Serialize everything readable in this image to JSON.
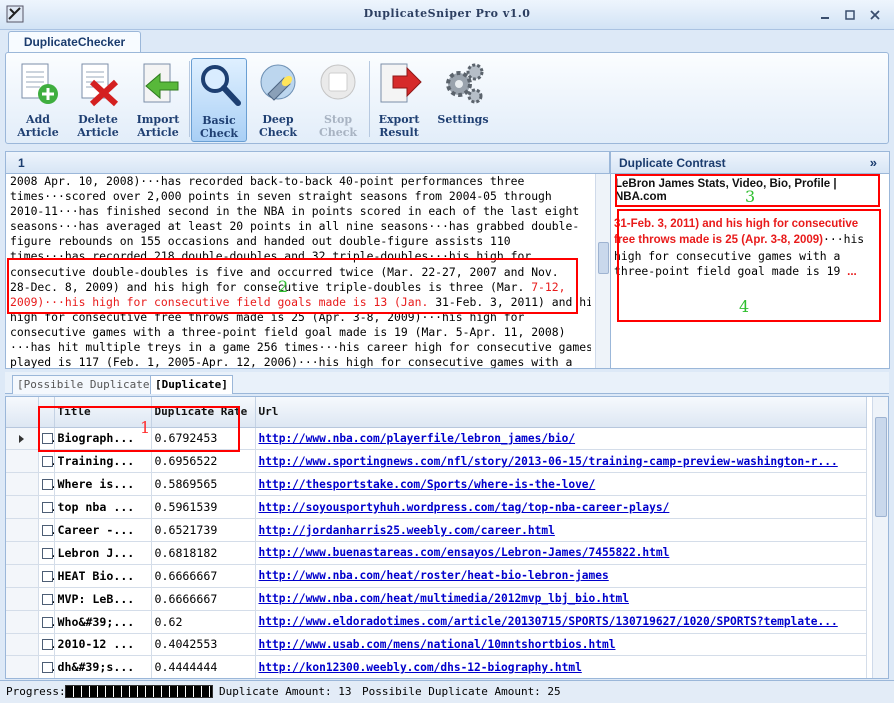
{
  "window": {
    "title": "DuplicateSniper Pro v1.0"
  },
  "ribbon": {
    "tab_label": "DuplicateChecker",
    "tools": [
      {
        "line1": "Add",
        "line2": "Article",
        "icon": "add-article-icon"
      },
      {
        "line1": "Delete",
        "line2": "Article",
        "icon": "delete-article-icon"
      },
      {
        "line1": "Import",
        "line2": "Article",
        "icon": "import-article-icon"
      },
      {
        "line1": "Basic",
        "line2": "Check",
        "icon": "magnifier-icon"
      },
      {
        "line1": "Deep",
        "line2": "Check",
        "icon": "flashlight-icon"
      },
      {
        "line1": "Stop",
        "line2": "Check",
        "icon": "stop-icon"
      },
      {
        "line1": "Export",
        "line2": "Result",
        "icon": "export-icon"
      },
      {
        "line1": "Settings",
        "line2": "",
        "icon": "gears-icon"
      }
    ]
  },
  "article": {
    "header": "1",
    "lines": [
      "2008 Apr. 10, 2008)···has recorded back-to-back 40-point performances three",
      "times···scored over 2,000 points in seven straight seasons from 2004-05 through",
      "2010-11···has finished second in the NBA in points scored in each of the last eight",
      "seasons···has averaged at least 20 points in all nine seasons···has grabbed double-",
      "figure rebounds on 155 occasions and handed out double-figure assists 110",
      "times···has recorded 218 double-doubles and 32 triple-doubles···his high for",
      "consecutive double-doubles is five and occurred twice (Mar. 22-27, 2007 and Nov."
    ],
    "line8_a": "28-Dec. 8, 2009) and his high for consecutive triple-doubles is three (Mar. ",
    "line8_b": "7-12,",
    "line9_a": "2009)···his high for consecutive field goals made is 13 (Jan. ",
    "line9_b": "31-Feb. 3, 2011) and his",
    "lines_after": [
      "high for consecutive free throws made is 25 (Apr. 3-8, 2009)···his high for",
      "consecutive games with a three-point field goal made is 19 (Mar. 5-Apr. 11, 2008)",
      "···has hit multiple treys in a game 256 times···his career high for consecutive games",
      "played is 117 (Feb. 1, 2005-Apr. 12, 2006)···his high for consecutive games with a"
    ]
  },
  "contrast": {
    "header": "Duplicate Contrast",
    "chevron": "»",
    "source_title": "LeBron James Stats, Video, Bio, Profile | NBA.com",
    "red_text": "31-Feb. 3, 2011) and his high for consecutive free throws made is 25 (Apr. 3-8, 2009)",
    "tail_text": "···his high for consecutive games with a three-point field goal made is 19 ",
    "ellipsis": "..."
  },
  "annotations": {
    "m1": "1",
    "m2": "2",
    "m3": "3",
    "m4": "4"
  },
  "tabs": {
    "possible": "[Possibile Duplicate]",
    "duplicate": "[Duplicate]"
  },
  "grid": {
    "columns": {
      "title": "Title",
      "rate": "Duplicate Rate",
      "url": "Url"
    },
    "rows": [
      {
        "title": "Biograph...",
        "rate": "0.6792453",
        "url": "http://www.nba.com/playerfile/lebron_james/bio/"
      },
      {
        "title": "Training...",
        "rate": "0.6956522",
        "url": "http://www.sportingnews.com/nfl/story/2013-06-15/training-camp-preview-washington-r..."
      },
      {
        "title": "Where is...",
        "rate": "0.5869565",
        "url": "http://thesportstake.com/Sports/where-is-the-love/"
      },
      {
        "title": "top nba ...",
        "rate": "0.5961539",
        "url": "http://soyousportyhuh.wordpress.com/tag/top-nba-career-plays/"
      },
      {
        "title": "Career -...",
        "rate": "0.6521739",
        "url": "http://jordanharris25.weebly.com/career.html"
      },
      {
        "title": "Lebron J...",
        "rate": "0.6818182",
        "url": "http://www.buenastareas.com/ensayos/Lebron-James/7455822.html"
      },
      {
        "title": "HEAT Bio...",
        "rate": "0.6666667",
        "url": "http://www.nba.com/heat/roster/heat-bio-lebron-james"
      },
      {
        "title": "MVP: LeB...",
        "rate": "0.6666667",
        "url": "http://www.nba.com/heat/multimedia/2012mvp_lbj_bio.html"
      },
      {
        "title": "Who&#39;...",
        "rate": "0.62",
        "url": "http://www.eldoradotimes.com/article/20130715/SPORTS/130719627/1020/SPORTS?template..."
      },
      {
        "title": "2010-12 ...",
        "rate": "0.4042553",
        "url": "http://www.usab.com/mens/national/10mntshortbios.html"
      },
      {
        "title": "dh&#39;s...",
        "rate": "0.4444444",
        "url": "http://kon12300.weebly.com/dhs-12-biography.html"
      }
    ]
  },
  "status": {
    "progress_label": "Progress:",
    "progress_fraction": 1.0,
    "dup_amount_label": "Duplicate Amount: 13",
    "possible_amount_label": "Possibile Duplicate Amount: 25"
  },
  "colors": {
    "accent": "#1b3c6e",
    "highlight_red": "#e81b1b",
    "link_blue": "#0000cc",
    "annotation_green": "#2fbf2f"
  }
}
